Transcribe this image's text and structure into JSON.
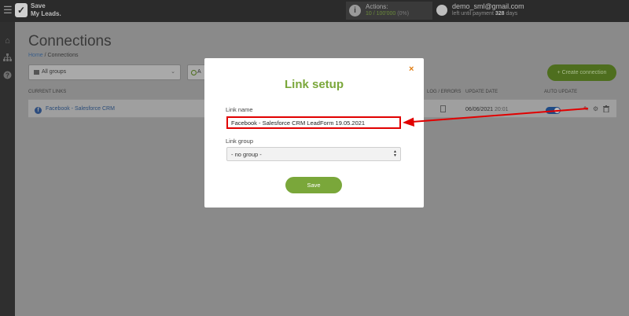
{
  "topbar": {
    "menu_icon": "hamburger-icon",
    "logo_line1": "Save",
    "logo_line2": "My Leads.",
    "actions_label": "Actions:",
    "actions_count": "10 / 100'000",
    "actions_percent": "(0%)",
    "user_email": "demo_sml@gmail.com",
    "user_sub_prefix": "left until payment",
    "user_days": "328",
    "user_sub_suffix": "days"
  },
  "sidebar": {
    "icons": [
      "home-icon",
      "sitemap-icon",
      "help-icon"
    ]
  },
  "page": {
    "title": "Connections",
    "breadcrumb_home": "Home",
    "breadcrumb_sep": "/",
    "breadcrumb_current": "Connections",
    "group_select": "All groups",
    "filter_button_partial": "A",
    "create_button": "+ Create connection",
    "columns": {
      "current_links": "CURRENT LINKS",
      "log_errors": "LOG / ERRORS",
      "update_date": "UPDATE DATE",
      "auto_update": "AUTO UPDATE"
    },
    "row": {
      "name": "Facebook - Salesforce CRM",
      "date": "06/06/2021",
      "time": "20:01",
      "auto_update": true
    }
  },
  "modal": {
    "close_glyph": "×",
    "title": "Link setup",
    "link_name_label": "Link name",
    "link_name_value": "Facebook - Salesforce CRM LeadForm 19.05.2021",
    "link_group_label": "Link group",
    "link_group_value": "- no group -",
    "save_label": "Save"
  },
  "colors": {
    "accent_green": "#7aa73a",
    "highlight_red": "#e10000",
    "close_orange": "#e07b0e"
  }
}
